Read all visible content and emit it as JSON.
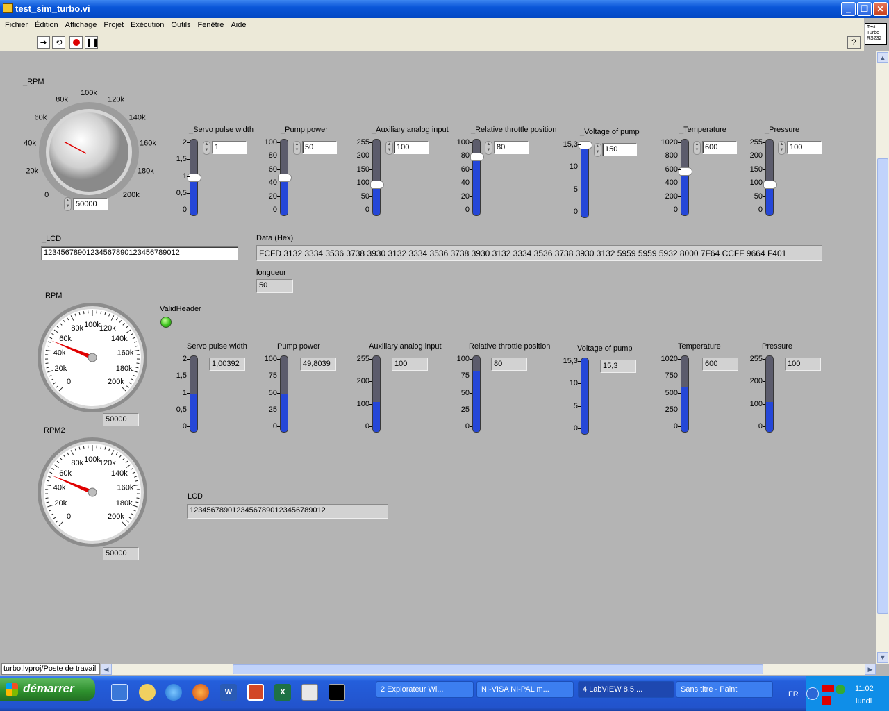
{
  "window": {
    "title": "test_sim_turbo.vi",
    "min": "_",
    "max": "❐",
    "close": "✕"
  },
  "menu": [
    "Fichier",
    "Édition",
    "Affichage",
    "Projet",
    "Exécution",
    "Outils",
    "Fenêtre",
    "Aide"
  ],
  "vi_icon": [
    "Test",
    "Turbo",
    "RS232"
  ],
  "help": "?",
  "controls": {
    "rpm_knob": {
      "label": "_RPM",
      "value": "50000",
      "ticks": [
        "0",
        "20k",
        "40k",
        "60k",
        "80k",
        "100k",
        "120k",
        "140k",
        "160k",
        "180k",
        "200k"
      ]
    },
    "sliders": [
      {
        "label": "_Servo pulse width",
        "value": "1",
        "ticks": [
          "2",
          "1,5",
          "1",
          "0,5",
          "0"
        ],
        "fraction": 0.5
      },
      {
        "label": "_Pump power",
        "value": "50",
        "ticks": [
          "100",
          "80",
          "60",
          "40",
          "20",
          "0"
        ],
        "fraction": 0.5
      },
      {
        "label": "_Auxiliary analog input",
        "value": "100",
        "ticks": [
          "255",
          "200",
          "150",
          "100",
          "50",
          "0"
        ],
        "fraction": 0.392
      },
      {
        "label": "_Relative throttle position",
        "value": "80",
        "ticks": [
          "100",
          "80",
          "60",
          "40",
          "20",
          "0"
        ],
        "fraction": 0.8
      },
      {
        "label": "_Voltage of pump",
        "value": "150",
        "ticks": [
          "15,3",
          "10",
          "5",
          "0"
        ],
        "fraction": 1.0
      },
      {
        "label": "_Temperature",
        "value": "600",
        "ticks": [
          "1020",
          "800",
          "600",
          "400",
          "200",
          "0"
        ],
        "fraction": 0.588
      },
      {
        "label": "_Pressure",
        "value": "100",
        "ticks": [
          "255",
          "200",
          "150",
          "100",
          "50",
          "0"
        ],
        "fraction": 0.392
      }
    ],
    "lcd_in": {
      "label": "_LCD",
      "value": "12345678901234567890123456789012"
    }
  },
  "data_hex": {
    "label": "Data (Hex)",
    "value": "FCFD 3132 3334 3536 3738 3930 3132 3334 3536 3738 3930 3132 3334 3536 3738 3930 3132 5959 5959 5932 8000 7F64 CCFF 9664 F401"
  },
  "longueur": {
    "label": "longueur",
    "value": "50"
  },
  "valid_header": {
    "label": "ValidHeader"
  },
  "gauges": [
    {
      "label": "RPM",
      "value": "50000",
      "ticks": [
        "0",
        "20k",
        "40k",
        "60k",
        "80k",
        "100k",
        "120k",
        "140k",
        "160k",
        "180k",
        "200k"
      ]
    },
    {
      "label": "RPM2",
      "value": "50000",
      "ticks": [
        "0",
        "20k",
        "40k",
        "60k",
        "80k",
        "100k",
        "120k",
        "140k",
        "160k",
        "180k",
        "200k"
      ]
    }
  ],
  "indicators": [
    {
      "label": "Servo pulse width",
      "value": "1,00392",
      "ticks": [
        "2",
        "1,5",
        "1",
        "0,5",
        "0"
      ],
      "fraction": 0.502
    },
    {
      "label": "Pump power",
      "value": "49,8039",
      "ticks": [
        "100",
        "75",
        "50",
        "25",
        "0"
      ],
      "fraction": 0.498
    },
    {
      "label": "Auxiliary analog input",
      "value": "100",
      "ticks": [
        "255",
        "200",
        "100",
        "0"
      ],
      "fraction": 0.392
    },
    {
      "label": "Relative throttle position",
      "value": "80",
      "ticks": [
        "100",
        "75",
        "50",
        "25",
        "0"
      ],
      "fraction": 0.8
    },
    {
      "label": "Voltage of pump",
      "value": "15,3",
      "ticks": [
        "15,3",
        "10",
        "5",
        "0"
      ],
      "fraction": 1.0
    },
    {
      "label": "Temperature",
      "value": "600",
      "ticks": [
        "1020",
        "750",
        "500",
        "250",
        "0"
      ],
      "fraction": 0.588
    },
    {
      "label": "Pressure",
      "value": "100",
      "ticks": [
        "255",
        "200",
        "100",
        "0"
      ],
      "fraction": 0.392
    }
  ],
  "lcd_out": {
    "label": "LCD",
    "value": "12345678901234567890123456789012"
  },
  "status_path": "turbo.lvproj/Poste de travail",
  "taskbar": {
    "start": "démarrer",
    "tasks": [
      "2 Explorateur Wi...",
      "NI-VISA NI-PAL m...",
      "4 LabVIEW 8.5 ...",
      "Sans titre - Paint"
    ],
    "lang": "FR",
    "time": "11:02",
    "day": "lundi"
  },
  "colors": {
    "panel": "#b4b4b4",
    "fill": "#2547d8",
    "needle": "#e00000",
    "led": "#3cc41d",
    "titlebar": "#0a56d8"
  }
}
